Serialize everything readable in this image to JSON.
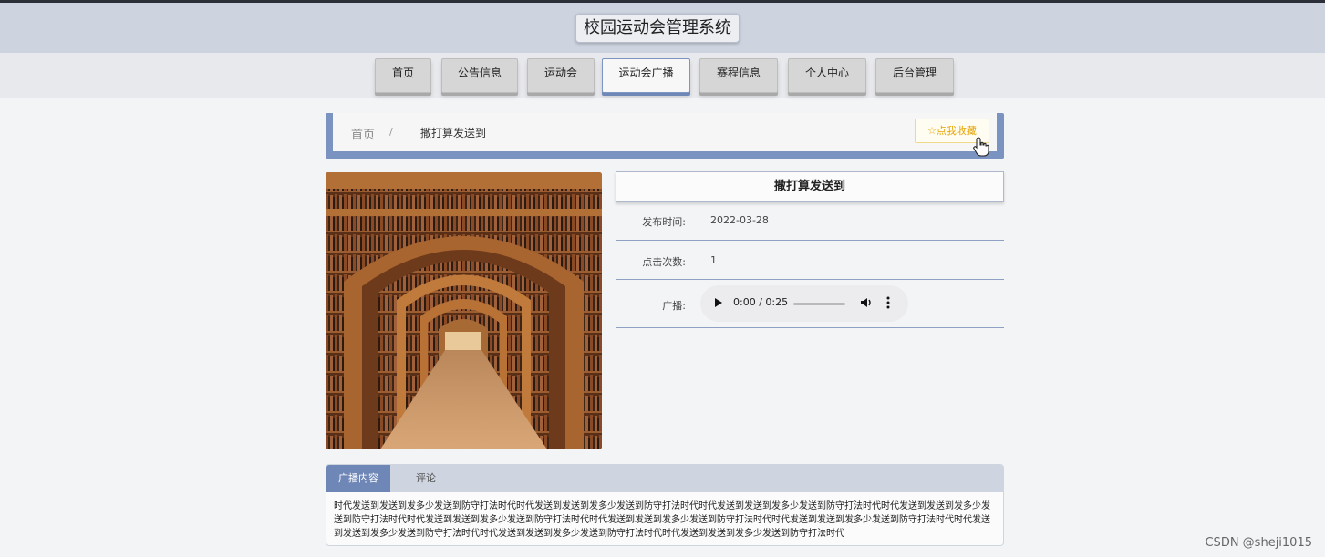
{
  "header": {
    "site_title": "校园运动会管理系统"
  },
  "nav": {
    "items": [
      {
        "label": "首页",
        "active": false
      },
      {
        "label": "公告信息",
        "active": false
      },
      {
        "label": "运动会",
        "active": false
      },
      {
        "label": "运动会广播",
        "active": true
      },
      {
        "label": "赛程信息",
        "active": false
      },
      {
        "label": "个人中心",
        "active": false
      },
      {
        "label": "后台管理",
        "active": false
      }
    ]
  },
  "breadcrumb": {
    "home": "首页",
    "separator": "/",
    "current": "撒打算发送到",
    "favorite_label": "☆点我收藏"
  },
  "detail": {
    "title": "撒打算发送到",
    "publish_time_label": "发布时间:",
    "publish_time_value": "2022-03-28",
    "clicks_label": "点击次数:",
    "clicks_value": "1",
    "broadcast_label": "广播:",
    "audio": {
      "time": "0:00 / 0:25",
      "progress": 0.0
    }
  },
  "tabs": {
    "items": [
      {
        "label": "广播内容",
        "active": true
      },
      {
        "label": "评论",
        "active": false
      }
    ],
    "content": "时代发送到发送到发多少发送到防守打法时代时代发送到发送到发多少发送到防守打法时代时代发送到发送到发多少发送到防守打法时代时代发送到发送到发多少发送到防守打法时代时代发送到发送到发多少发送到防守打法时代时代发送到发送到发多少发送到防守打法时代时代发送到发送到发多少发送到防守打法时代时代发送到发送到发多少发送到防守打法时代时代发送到发送到发多少发送到防守打法时代时代发送到发送到发多少发送到防守打法时代"
  },
  "watermark": "CSDN @sheji1015",
  "colors": {
    "accent": "#7b93c0",
    "favorite": "#e6a300"
  }
}
